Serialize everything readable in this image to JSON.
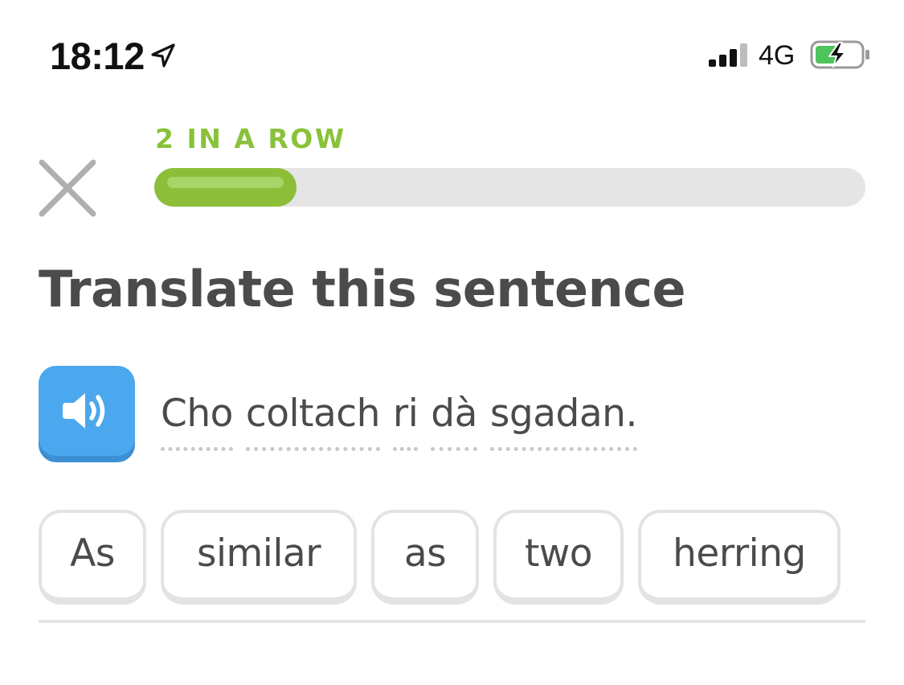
{
  "status_bar": {
    "time": "18:12",
    "network": "4G",
    "location_icon": "location-arrow-icon",
    "signal_icon": "cellular-signal-icon",
    "battery_icon": "battery-charging-icon"
  },
  "header": {
    "streak_label": "2 IN A ROW",
    "progress_fraction": 0.2,
    "close_icon": "close-icon"
  },
  "prompt": {
    "title": "Translate this sentence",
    "speaker_icon": "speaker-icon",
    "sentence_words": [
      "Cho",
      "coltach",
      "ri",
      "dà",
      "sgadan."
    ]
  },
  "answer_tiles": [
    "As",
    "similar",
    "as",
    "two",
    "herring"
  ],
  "colors": {
    "accent_green": "#89c23a",
    "speaker_blue": "#4ba7ee",
    "text": "#4b4b4b",
    "track": "#e5e5e5"
  }
}
